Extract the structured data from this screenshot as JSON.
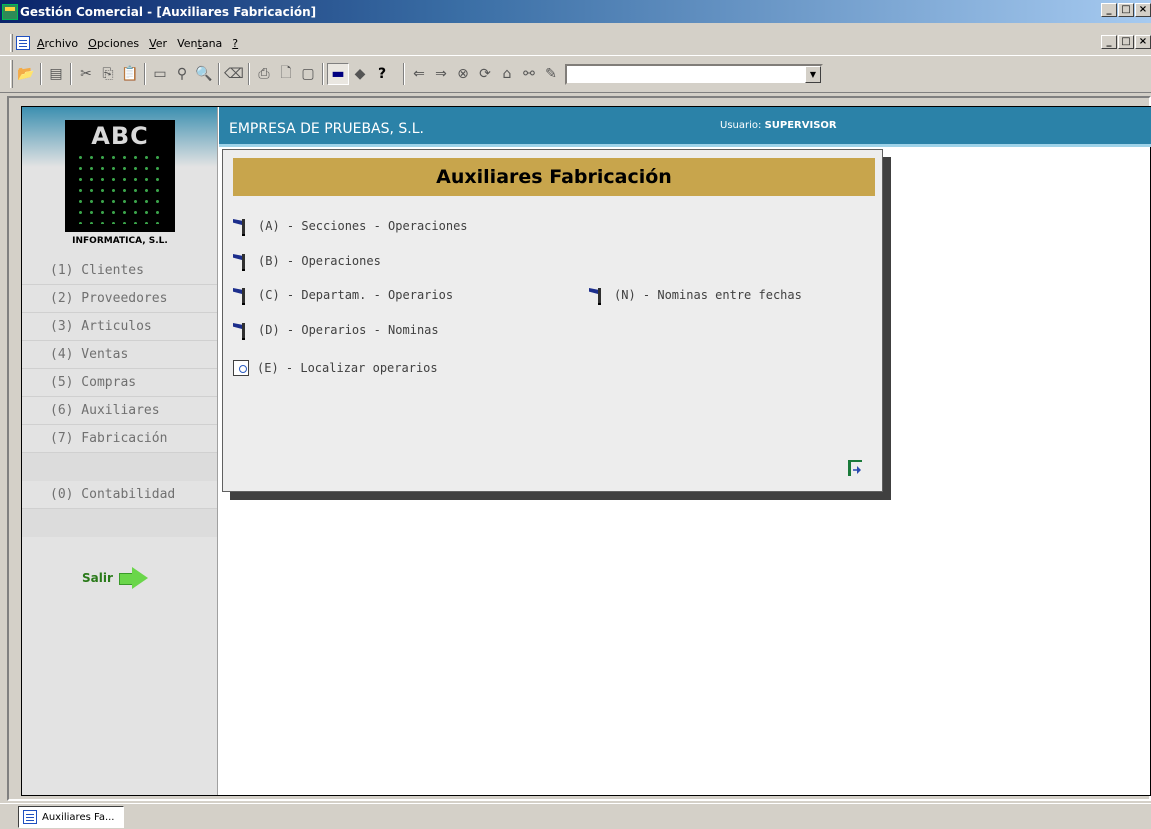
{
  "window": {
    "title": "Gestión Comercial - [Auxiliares Fabricación]",
    "controls": [
      "_",
      "□",
      "×"
    ]
  },
  "menu": {
    "items": [
      {
        "label": "Archivo",
        "key": "A",
        "rest": "rchivo"
      },
      {
        "label": "Opciones",
        "key": "O",
        "rest": "pciones"
      },
      {
        "label": "Ver",
        "key": "V",
        "rest": "er"
      },
      {
        "label": "Ventana",
        "pre": "Ven",
        "key": "t",
        "rest": "ana"
      },
      {
        "label": "?",
        "key": "?",
        "rest": ""
      }
    ]
  },
  "toolbar": {
    "buttons": [
      "open-icon",
      "edit-icon",
      "cut-icon",
      "copy-icon",
      "paste-icon",
      "window-icon",
      "binoculars-icon",
      "magnifier-icon",
      "eraser-icon",
      "print-icon",
      "print-preview-icon",
      "page-icon",
      "monitor-icon",
      "diamond-icon",
      "help-icon",
      "back-icon",
      "forward-icon",
      "stop-icon",
      "refresh-icon",
      "home-icon",
      "search-icon",
      "edit-doc-icon"
    ],
    "combo_value": ""
  },
  "sidebar": {
    "logo_text": "ABC",
    "logo_subtitle": "INFORMATICA, S.L.",
    "items": [
      "(1) Clientes",
      "(2) Proveedores",
      "(3) Articulos",
      "(4) Ventas",
      "(5) Compras",
      "(6) Auxiliares",
      "(7) Fabricación",
      "",
      "(0) Contabilidad",
      ""
    ],
    "salir_label": "Salir"
  },
  "header": {
    "company": "EMPRESA DE PRUEBAS, S.L.",
    "user_label": "Usuario:",
    "user_value": "SUPERVISOR"
  },
  "dialog": {
    "title": "Auxiliares Fabricación",
    "options": [
      {
        "label": "(A) - Secciones - Operaciones",
        "icon": "flag-icon"
      },
      {
        "label": "(B) - Operaciones",
        "icon": "flag-icon"
      },
      {
        "label": "(C) - Departam. - Operarios",
        "icon": "flag-icon"
      },
      {
        "label": "(N) - Nominas entre fechas",
        "icon": "flag-icon"
      },
      {
        "label": "(D) - Operarios - Nominas",
        "icon": "flag-icon"
      },
      {
        "label": "(E) - Localizar operarios",
        "icon": "magnifier-icon"
      }
    ]
  },
  "taskbar": {
    "item_label": "Auxiliares Fa..."
  }
}
